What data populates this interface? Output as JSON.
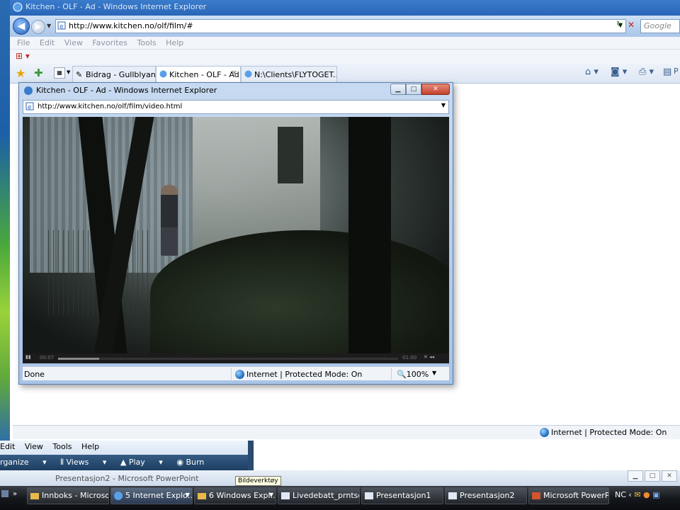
{
  "main_window": {
    "title": "Kitchen - OLF - Ad - Windows Internet Explorer",
    "url": "http://www.kitchen.no/olf/film/#",
    "search_placeholder": "Google",
    "menu": [
      "File",
      "Edit",
      "View",
      "Favorites",
      "Tools",
      "Help"
    ],
    "tabs": [
      {
        "label": "Bidrag - Gullblyanten",
        "active": false
      },
      {
        "label": "Kitchen - OLF - Ad",
        "active": true
      },
      {
        "label": "N:\\Clients\\FLYTOGET...",
        "active": false
      }
    ],
    "toolbar_right_label": "P",
    "status_zone": "Internet | Protected Mode: On"
  },
  "popup": {
    "title": "Kitchen - OLF - Ad - Windows Internet Explorer",
    "url": "http://www.kitchen.no/olf/film/video.html",
    "video": {
      "elapsed": "00:07",
      "duration": "01:00",
      "progress_fraction": 0.12
    },
    "status_text": "Done",
    "status_zone": "Internet | Protected Mode: On",
    "zoom": "100%"
  },
  "explorer": {
    "menu": [
      "Edit",
      "View",
      "Tools",
      "Help"
    ],
    "toolbar": [
      "rganize",
      "Views",
      "Play",
      "Burn"
    ]
  },
  "powerpoint": {
    "title": "Presentasjon2 - Microsoft PowerPoint",
    "tooltip": "Bildeverktøy"
  },
  "taskbar": {
    "buttons": [
      {
        "label": "Innboks - Microso..."
      },
      {
        "label": "5 Internet Explo...",
        "active": true
      },
      {
        "label": "6 Windows Expl..."
      },
      {
        "label": "Livedebatt_prntsc..."
      },
      {
        "label": "Presentasjon1"
      },
      {
        "label": "Presentasjon2"
      },
      {
        "label": "Microsoft PowerP..."
      }
    ],
    "tray_lang": "NC"
  }
}
